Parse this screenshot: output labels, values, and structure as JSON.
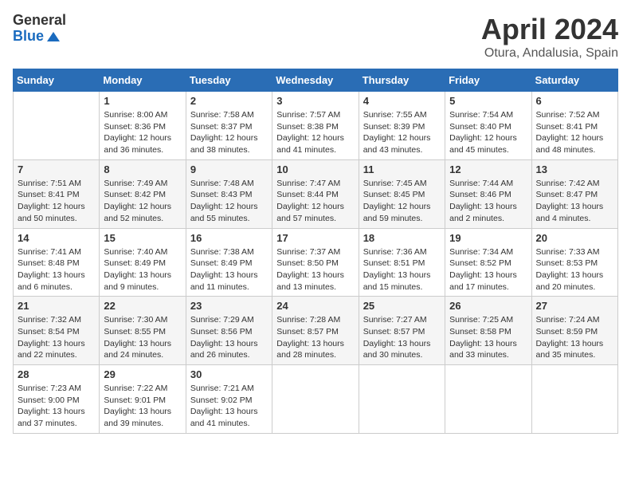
{
  "header": {
    "logo_general": "General",
    "logo_blue": "Blue",
    "month": "April 2024",
    "location": "Otura, Andalusia, Spain"
  },
  "columns": [
    "Sunday",
    "Monday",
    "Tuesday",
    "Wednesday",
    "Thursday",
    "Friday",
    "Saturday"
  ],
  "weeks": [
    [
      {
        "date": "",
        "info": ""
      },
      {
        "date": "1",
        "info": "Sunrise: 8:00 AM\nSunset: 8:36 PM\nDaylight: 12 hours\nand 36 minutes."
      },
      {
        "date": "2",
        "info": "Sunrise: 7:58 AM\nSunset: 8:37 PM\nDaylight: 12 hours\nand 38 minutes."
      },
      {
        "date": "3",
        "info": "Sunrise: 7:57 AM\nSunset: 8:38 PM\nDaylight: 12 hours\nand 41 minutes."
      },
      {
        "date": "4",
        "info": "Sunrise: 7:55 AM\nSunset: 8:39 PM\nDaylight: 12 hours\nand 43 minutes."
      },
      {
        "date": "5",
        "info": "Sunrise: 7:54 AM\nSunset: 8:40 PM\nDaylight: 12 hours\nand 45 minutes."
      },
      {
        "date": "6",
        "info": "Sunrise: 7:52 AM\nSunset: 8:41 PM\nDaylight: 12 hours\nand 48 minutes."
      }
    ],
    [
      {
        "date": "7",
        "info": "Sunrise: 7:51 AM\nSunset: 8:41 PM\nDaylight: 12 hours\nand 50 minutes."
      },
      {
        "date": "8",
        "info": "Sunrise: 7:49 AM\nSunset: 8:42 PM\nDaylight: 12 hours\nand 52 minutes."
      },
      {
        "date": "9",
        "info": "Sunrise: 7:48 AM\nSunset: 8:43 PM\nDaylight: 12 hours\nand 55 minutes."
      },
      {
        "date": "10",
        "info": "Sunrise: 7:47 AM\nSunset: 8:44 PM\nDaylight: 12 hours\nand 57 minutes."
      },
      {
        "date": "11",
        "info": "Sunrise: 7:45 AM\nSunset: 8:45 PM\nDaylight: 12 hours\nand 59 minutes."
      },
      {
        "date": "12",
        "info": "Sunrise: 7:44 AM\nSunset: 8:46 PM\nDaylight: 13 hours\nand 2 minutes."
      },
      {
        "date": "13",
        "info": "Sunrise: 7:42 AM\nSunset: 8:47 PM\nDaylight: 13 hours\nand 4 minutes."
      }
    ],
    [
      {
        "date": "14",
        "info": "Sunrise: 7:41 AM\nSunset: 8:48 PM\nDaylight: 13 hours\nand 6 minutes."
      },
      {
        "date": "15",
        "info": "Sunrise: 7:40 AM\nSunset: 8:49 PM\nDaylight: 13 hours\nand 9 minutes."
      },
      {
        "date": "16",
        "info": "Sunrise: 7:38 AM\nSunset: 8:49 PM\nDaylight: 13 hours\nand 11 minutes."
      },
      {
        "date": "17",
        "info": "Sunrise: 7:37 AM\nSunset: 8:50 PM\nDaylight: 13 hours\nand 13 minutes."
      },
      {
        "date": "18",
        "info": "Sunrise: 7:36 AM\nSunset: 8:51 PM\nDaylight: 13 hours\nand 15 minutes."
      },
      {
        "date": "19",
        "info": "Sunrise: 7:34 AM\nSunset: 8:52 PM\nDaylight: 13 hours\nand 17 minutes."
      },
      {
        "date": "20",
        "info": "Sunrise: 7:33 AM\nSunset: 8:53 PM\nDaylight: 13 hours\nand 20 minutes."
      }
    ],
    [
      {
        "date": "21",
        "info": "Sunrise: 7:32 AM\nSunset: 8:54 PM\nDaylight: 13 hours\nand 22 minutes."
      },
      {
        "date": "22",
        "info": "Sunrise: 7:30 AM\nSunset: 8:55 PM\nDaylight: 13 hours\nand 24 minutes."
      },
      {
        "date": "23",
        "info": "Sunrise: 7:29 AM\nSunset: 8:56 PM\nDaylight: 13 hours\nand 26 minutes."
      },
      {
        "date": "24",
        "info": "Sunrise: 7:28 AM\nSunset: 8:57 PM\nDaylight: 13 hours\nand 28 minutes."
      },
      {
        "date": "25",
        "info": "Sunrise: 7:27 AM\nSunset: 8:57 PM\nDaylight: 13 hours\nand 30 minutes."
      },
      {
        "date": "26",
        "info": "Sunrise: 7:25 AM\nSunset: 8:58 PM\nDaylight: 13 hours\nand 33 minutes."
      },
      {
        "date": "27",
        "info": "Sunrise: 7:24 AM\nSunset: 8:59 PM\nDaylight: 13 hours\nand 35 minutes."
      }
    ],
    [
      {
        "date": "28",
        "info": "Sunrise: 7:23 AM\nSunset: 9:00 PM\nDaylight: 13 hours\nand 37 minutes."
      },
      {
        "date": "29",
        "info": "Sunrise: 7:22 AM\nSunset: 9:01 PM\nDaylight: 13 hours\nand 39 minutes."
      },
      {
        "date": "30",
        "info": "Sunrise: 7:21 AM\nSunset: 9:02 PM\nDaylight: 13 hours\nand 41 minutes."
      },
      {
        "date": "",
        "info": ""
      },
      {
        "date": "",
        "info": ""
      },
      {
        "date": "",
        "info": ""
      },
      {
        "date": "",
        "info": ""
      }
    ]
  ]
}
